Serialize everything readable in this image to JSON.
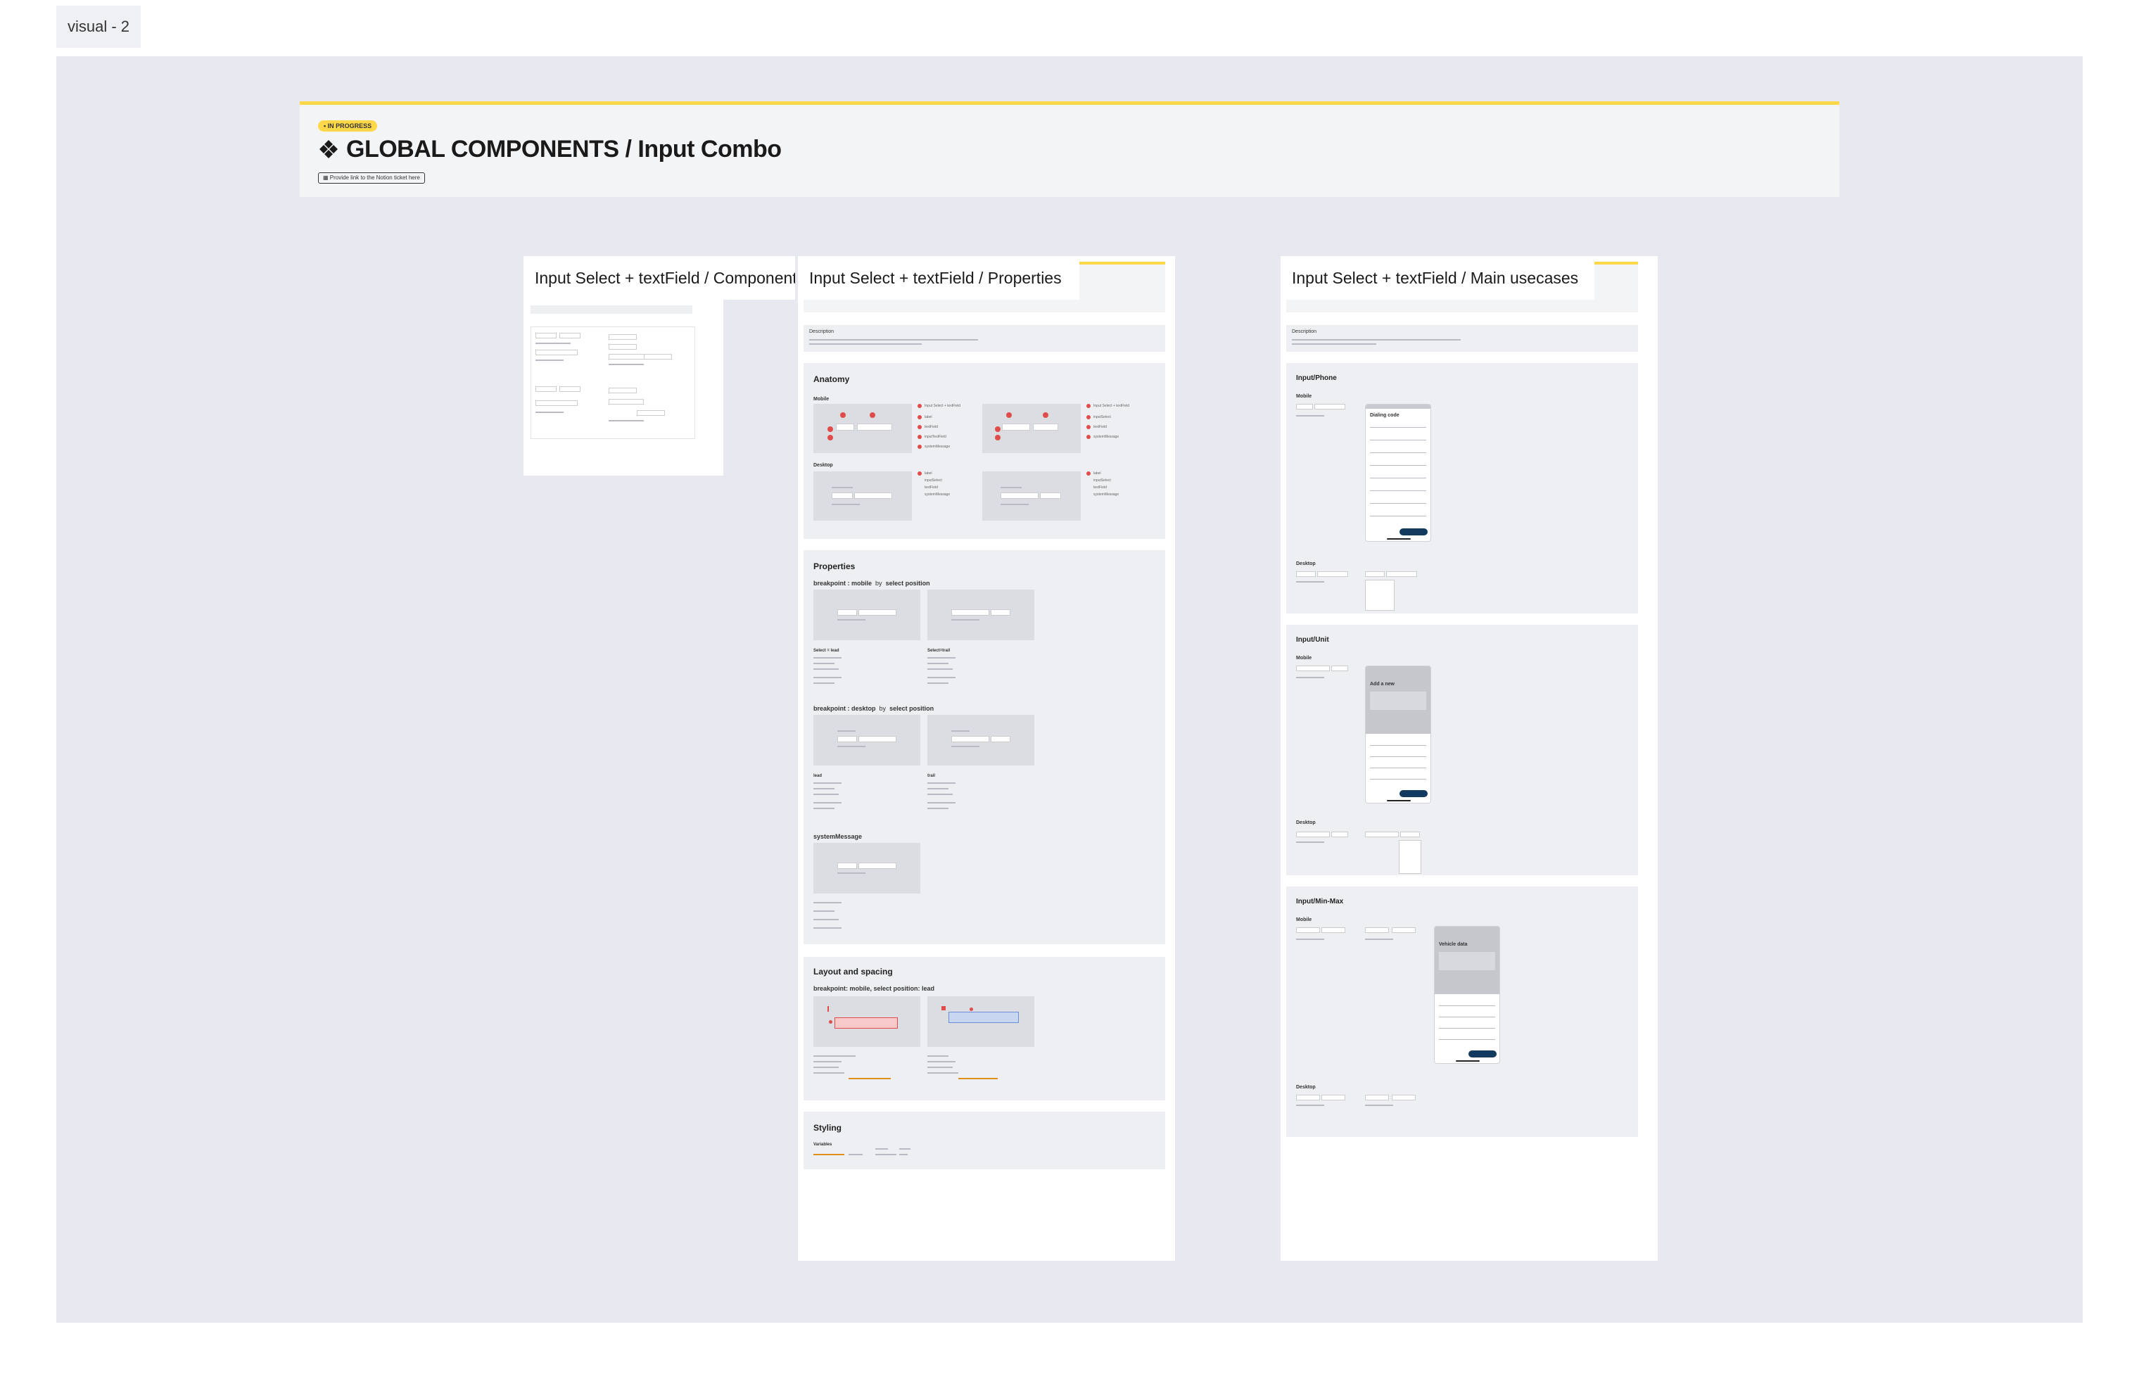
{
  "page_tab": "visual - 2",
  "colors": {
    "canvas": "#e8e9f0",
    "accent": "#ffd84a",
    "panel": "#eeeff2",
    "navy": "#12395e",
    "marker": "#e04b4b"
  },
  "hero": {
    "badge": "• IN PROGRESS",
    "icon": "component-diamond-icon",
    "title": "GLOBAL COMPONENTS / Input Combo",
    "link": "Provide link to the Notion ticket here"
  },
  "frames": {
    "component": {
      "label": "Input Select + textField / Component"
    },
    "properties": {
      "label": "Input Select + textField / Properties",
      "description": "Description",
      "anatomy": {
        "title": "Anatomy",
        "mobile": "Mobile",
        "desktop": "Desktop",
        "legend_mobile": [
          "Input Select + textField",
          "label",
          "inputSelect",
          "textField",
          "inputTextField",
          "systemMessage"
        ],
        "legend_desktop": [
          "label",
          "inputSelect",
          "textField",
          "systemMessage"
        ]
      },
      "properties": {
        "title": "Properties",
        "row1_label": "breakpoint",
        "row1_value": "mobile",
        "row1_by": "by",
        "row1_prop": "select position",
        "row2_label": "breakpoint",
        "row2_value": "desktop",
        "row2_by": "by",
        "row2_prop": "select position",
        "caption_a": "Select = lead",
        "caption_b": "Select=trail",
        "caption_c": "lead",
        "caption_d": "trail",
        "system_message": "systemMessage"
      },
      "layout": {
        "title": "Layout and spacing",
        "sub": "breakpoint: mobile, select position: lead"
      },
      "styling": {
        "title": "Styling",
        "sub": "Variables"
      }
    },
    "usecases": {
      "label": "Input Select + textField / Main usecases",
      "description": "Description",
      "sections": [
        {
          "title": "Input/Phone",
          "mobile": "Mobile",
          "desktop": "Desktop",
          "sheet_title": "Dialing code"
        },
        {
          "title": "Input/Unit",
          "mobile": "Mobile",
          "desktop": "Desktop",
          "sheet_title": "Add a new"
        },
        {
          "title": "Input/Min-Max",
          "mobile": "Mobile",
          "desktop": "Desktop",
          "sheet_title": "Vehicle data"
        }
      ]
    }
  }
}
